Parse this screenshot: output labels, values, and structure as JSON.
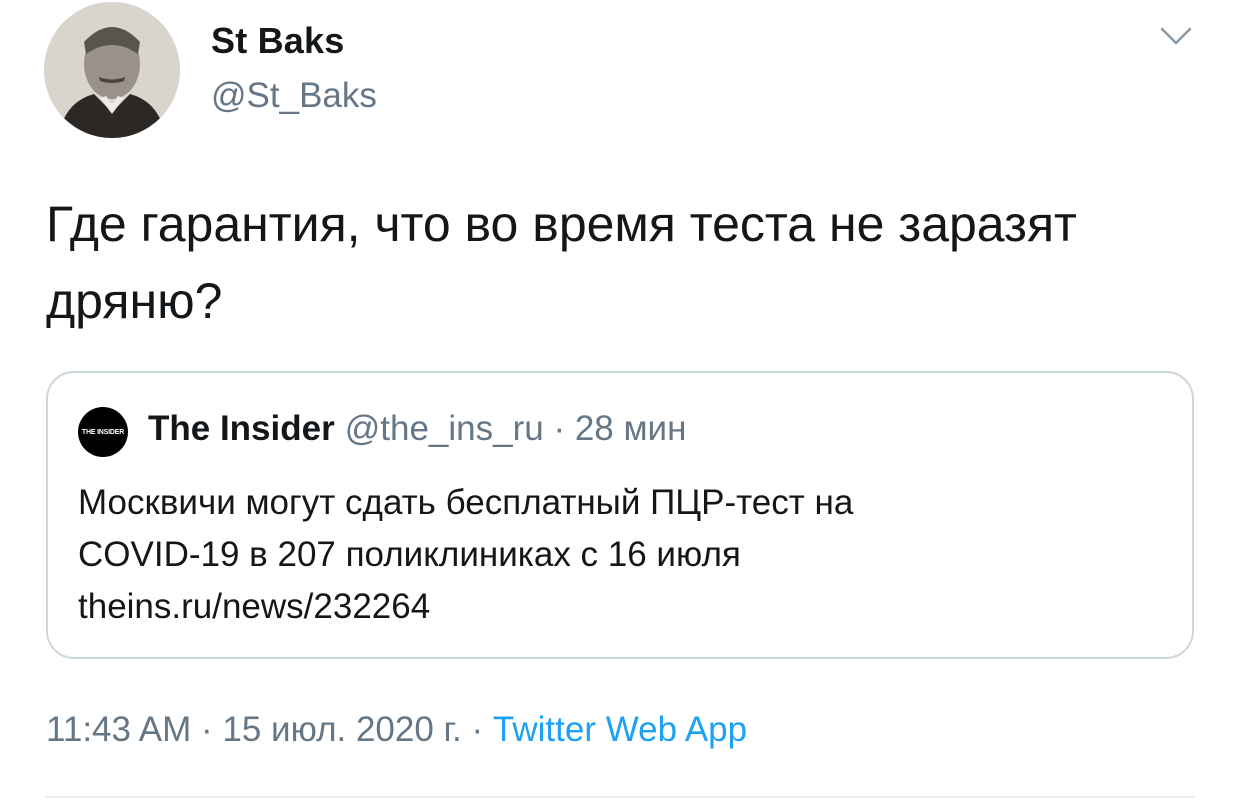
{
  "author": {
    "name": "St Baks",
    "handle": "@St_Baks"
  },
  "tweet": {
    "text": "Где гарантия, что во время теста не заразят дряню?"
  },
  "quote": {
    "avatar_text": "THE INSIDER",
    "name": "The Insider",
    "handle": "@the_ins_ru",
    "separator": "·",
    "time": "28 мин",
    "text_lines": [
      "Москвичи могут сдать бесплатный ПЦР-тест на",
      "COVID-19 в 207 поликлиниках с 16 июля",
      "theins.ru/news/232264"
    ]
  },
  "footer": {
    "time": "11:43 AM",
    "date": "15 июл. 2020 г.",
    "separator": "·",
    "source": "Twitter Web App"
  },
  "icons": {
    "menu": "chevron-down-icon"
  },
  "colors": {
    "text": "#14171a",
    "secondary": "#657786",
    "link": "#1da1f2",
    "border": "#ccd6dd"
  }
}
